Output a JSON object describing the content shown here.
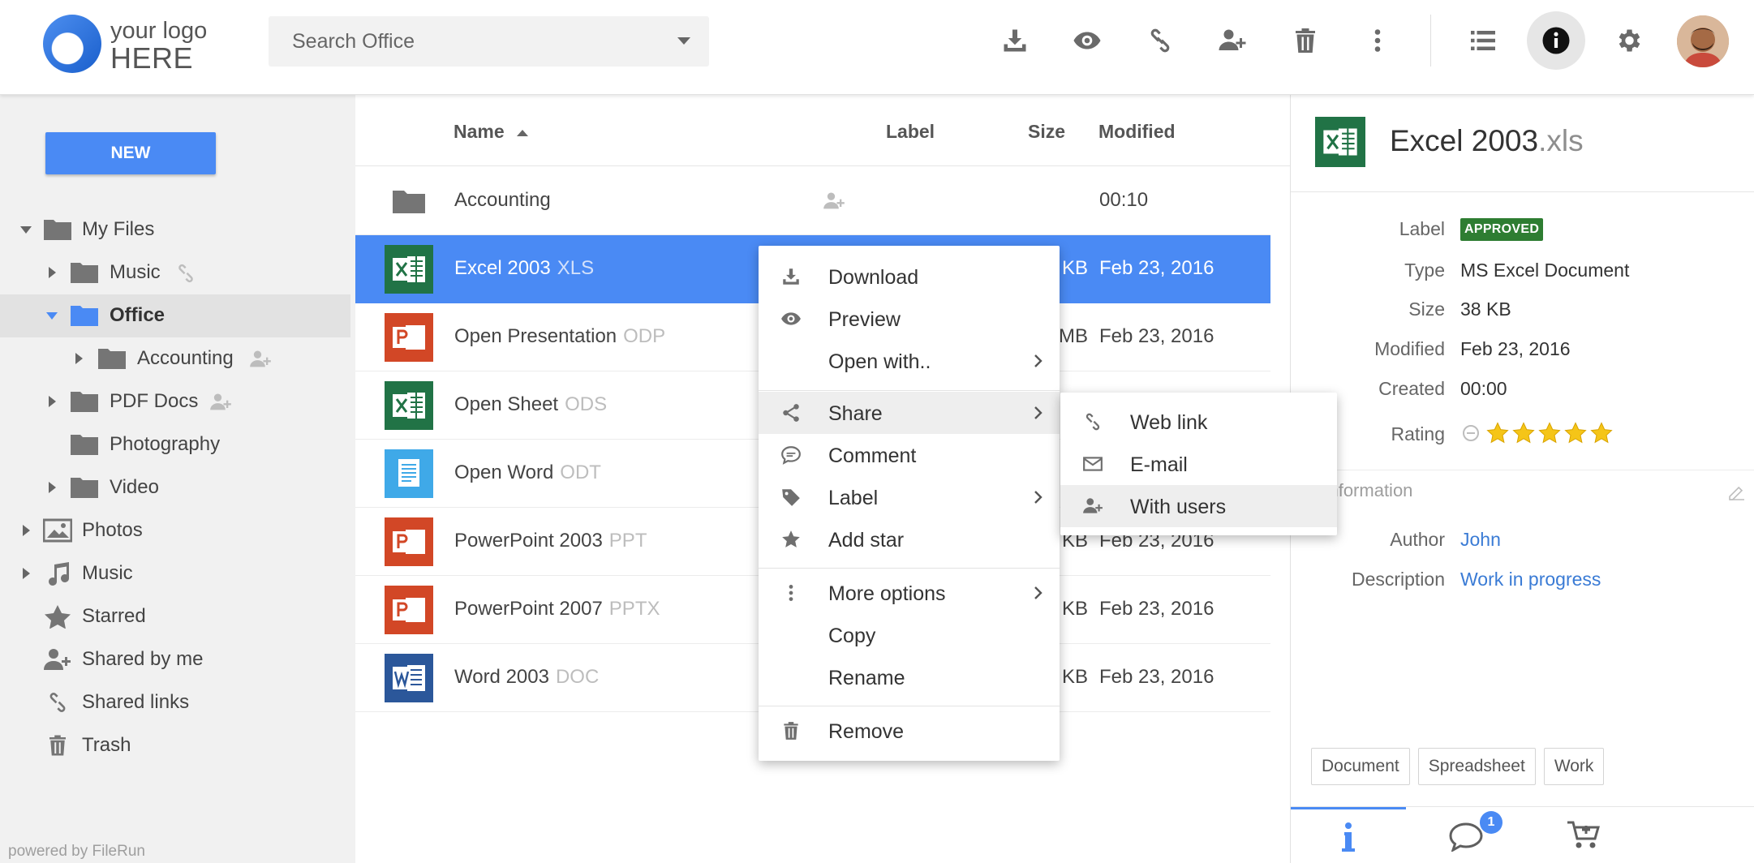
{
  "logo": {
    "line1": "your logo",
    "line2": "HERE"
  },
  "search": {
    "placeholder": "Search Office"
  },
  "toolbar": {
    "icons": [
      "download-icon",
      "preview-icon",
      "link-icon",
      "add-user-icon",
      "trash-icon",
      "more-vert-icon",
      "list-view-icon",
      "info-icon",
      "settings-icon"
    ]
  },
  "sidebar": {
    "new_label": "NEW",
    "items": [
      {
        "label": "My Files"
      },
      {
        "label": "Music"
      },
      {
        "label": "Office"
      },
      {
        "label": "Accounting"
      },
      {
        "label": "PDF Docs"
      },
      {
        "label": "Photography"
      },
      {
        "label": "Video"
      },
      {
        "label": "Photos"
      },
      {
        "label": "Music"
      },
      {
        "label": "Starred"
      },
      {
        "label": "Shared by me"
      },
      {
        "label": "Shared links"
      },
      {
        "label": "Trash"
      }
    ],
    "powered": "powered by FileRun"
  },
  "list": {
    "columns": {
      "name": "Name",
      "label": "Label",
      "size": "Size",
      "modified": "Modified"
    },
    "rows": [
      {
        "name": "Accounting",
        "ext": "",
        "size": "",
        "modified": "00:10",
        "kind": "folder"
      },
      {
        "name": "Excel 2003",
        "ext": "XLS",
        "size": "KB",
        "modified": "Feb 23, 2016",
        "kind": "excel"
      },
      {
        "name": "Open Presentation",
        "ext": "ODP",
        "size": "MB",
        "modified": "Feb 23, 2016",
        "kind": "powerpoint"
      },
      {
        "name": "Open Sheet",
        "ext": "ODS",
        "size": "",
        "modified": "",
        "kind": "excel"
      },
      {
        "name": "Open Word",
        "ext": "ODT",
        "size": "",
        "modified": "",
        "kind": "doc-blue"
      },
      {
        "name": "PowerPoint 2003",
        "ext": "PPT",
        "size": "KB",
        "modified": "Feb 23, 2016",
        "kind": "powerpoint"
      },
      {
        "name": "PowerPoint 2007",
        "ext": "PPTX",
        "size": "KB",
        "modified": "Feb 23, 2016",
        "kind": "powerpoint"
      },
      {
        "name": "Word 2003",
        "ext": "DOC",
        "size": "KB",
        "modified": "Feb 23, 2016",
        "kind": "word"
      }
    ]
  },
  "context_menu": {
    "items": [
      {
        "label": "Download",
        "icon": "download-icon"
      },
      {
        "label": "Preview",
        "icon": "eye-icon"
      },
      {
        "label": "Open with..",
        "icon": ""
      },
      {
        "label": "Share",
        "icon": "share-icon"
      },
      {
        "label": "Comment",
        "icon": "comment-icon"
      },
      {
        "label": "Label",
        "icon": "tag-icon"
      },
      {
        "label": "Add star",
        "icon": "star-icon"
      },
      {
        "label": "More options",
        "icon": "more-vert-icon"
      },
      {
        "label": "Copy",
        "icon": ""
      },
      {
        "label": "Rename",
        "icon": ""
      },
      {
        "label": "Remove",
        "icon": "trash-icon"
      }
    ],
    "share_submenu": [
      {
        "label": "Web link",
        "icon": "link-icon"
      },
      {
        "label": "E-mail",
        "icon": "email-icon"
      },
      {
        "label": "With users",
        "icon": "add-user-icon"
      }
    ]
  },
  "details": {
    "title": "Excel 2003",
    "title_ext": ".xls",
    "props": {
      "label_key": "Label",
      "label_value": "APPROVED",
      "type_key": "Type",
      "type_value": "MS Excel Document",
      "size_key": "Size",
      "size_value": "38 KB",
      "modified_key": "Modified",
      "modified_value": "Feb 23, 2016",
      "created_key": "Created",
      "created_value": "00:00",
      "rating_key": "Rating"
    },
    "rating": 5,
    "section_title": "ous information",
    "meta": {
      "author_key": "Author",
      "author_value": "John",
      "description_key": "Description",
      "description_value": "Work in progress"
    },
    "tags": [
      "Document",
      "Spreadsheet",
      "Work"
    ],
    "comment_count": "1"
  },
  "colors": {
    "accent": "#4a8af4",
    "approved": "#2e7d32",
    "excel": "#217346",
    "powerpoint": "#d24726",
    "word": "#2b579a",
    "star": "#f5c518"
  }
}
